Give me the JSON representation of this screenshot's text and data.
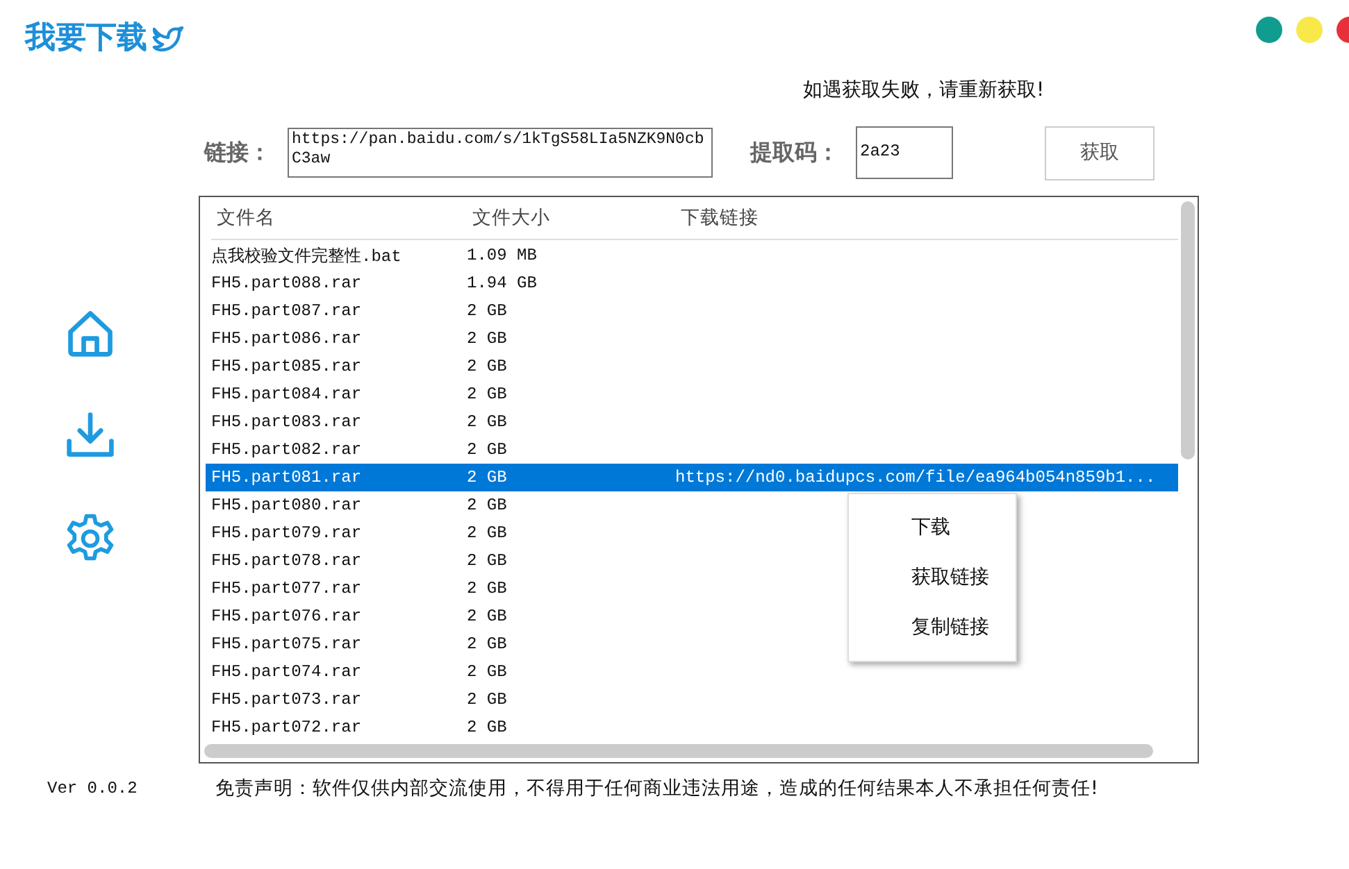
{
  "app_title": "我要下载",
  "window_dots": [
    {
      "color": "#109d8f"
    },
    {
      "color": "#f8e84a"
    },
    {
      "color": "#e8303c"
    }
  ],
  "notice": "如遇获取失败，请重新获取!",
  "form": {
    "link_label": "链接：",
    "link_value": "https://pan.baidu.com/s/1kTgS58LIa5NZK9N0cbC3aw",
    "code_label": "提取码：",
    "code_value": "2a23",
    "fetch_button": "获取"
  },
  "sidebar": [
    {
      "kind": "home"
    },
    {
      "kind": "download"
    },
    {
      "kind": "settings"
    }
  ],
  "table": {
    "columns": [
      "文件名",
      "文件大小",
      "下载链接"
    ],
    "rows": [
      {
        "name": "点我校验文件完整性.bat",
        "size": "1.09 MB",
        "selected": false
      },
      {
        "name": "FH5.part088.rar",
        "size": "1.94 GB",
        "selected": false
      },
      {
        "name": "FH5.part087.rar",
        "size": "2 GB",
        "selected": false
      },
      {
        "name": "FH5.part086.rar",
        "size": "2 GB",
        "selected": false
      },
      {
        "name": "FH5.part085.rar",
        "size": "2 GB",
        "selected": false
      },
      {
        "name": "FH5.part084.rar",
        "size": "2 GB",
        "selected": false
      },
      {
        "name": "FH5.part083.rar",
        "size": "2 GB",
        "selected": false
      },
      {
        "name": "FH5.part082.rar",
        "size": "2 GB",
        "selected": false
      },
      {
        "name": "FH5.part081.rar",
        "size": "2 GB",
        "link": "https://nd0.baidupcs.com/file/ea964b054n859b1...",
        "selected": true
      },
      {
        "name": "FH5.part080.rar",
        "size": "2 GB",
        "selected": false
      },
      {
        "name": "FH5.part079.rar",
        "size": "2 GB",
        "selected": false
      },
      {
        "name": "FH5.part078.rar",
        "size": "2 GB",
        "selected": false
      },
      {
        "name": "FH5.part077.rar",
        "size": "2 GB",
        "selected": false
      },
      {
        "name": "FH5.part076.rar",
        "size": "2 GB",
        "selected": false
      },
      {
        "name": "FH5.part075.rar",
        "size": "2 GB",
        "selected": false
      },
      {
        "name": "FH5.part074.rar",
        "size": "2 GB",
        "selected": false
      },
      {
        "name": "FH5.part073.rar",
        "size": "2 GB",
        "selected": false
      },
      {
        "name": "FH5.part072.rar",
        "size": "2 GB",
        "selected": false
      }
    ]
  },
  "context_menu": [
    "下载",
    "获取链接",
    "复制链接"
  ],
  "version": "Ver 0.0.2",
  "disclaimer": "免责声明：软件仅供内部交流使用，不得用于任何商业违法用途，造成的任何结果本人不承担任何责任!"
}
